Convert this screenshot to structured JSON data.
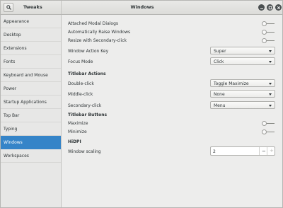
{
  "header": {
    "app_title": "Tweaks",
    "window_title": "Windows"
  },
  "sidebar": {
    "items": [
      {
        "label": "Appearance",
        "active": false
      },
      {
        "label": "Desktop",
        "active": false
      },
      {
        "label": "Extensions",
        "active": false
      },
      {
        "label": "Fonts",
        "active": false
      },
      {
        "label": "Keyboard and Mouse",
        "active": false
      },
      {
        "label": "Power",
        "active": false
      },
      {
        "label": "Startup Applications",
        "active": false
      },
      {
        "label": "Top Bar",
        "active": false
      },
      {
        "label": "Typing",
        "active": false
      },
      {
        "label": "Windows",
        "active": true
      },
      {
        "label": "Workspaces",
        "active": false
      }
    ]
  },
  "main": {
    "attached_modal_dialogs": {
      "label": "Attached Modal Dialogs",
      "on": false
    },
    "automatically_raise_windows": {
      "label": "Automatically Raise Windows",
      "on": false
    },
    "resize_secondary_click": {
      "label": "Resize with Secondary-click",
      "on": false
    },
    "window_action_key": {
      "label": "Window Action Key",
      "value": "Super"
    },
    "focus_mode": {
      "label": "Focus Mode",
      "value": "Click"
    },
    "titlebar_actions": {
      "title": "Titlebar Actions",
      "double_click": {
        "label": "Double-click",
        "value": "Toggle Maximize"
      },
      "middle_click": {
        "label": "Middle-click",
        "value": "None"
      },
      "secondary_click": {
        "label": "Secondary-click",
        "value": "Menu"
      }
    },
    "titlebar_buttons": {
      "title": "Titlebar Buttons",
      "maximize": {
        "label": "Maximize",
        "on": false
      },
      "minimize": {
        "label": "Minimize",
        "on": false
      }
    },
    "hidpi": {
      "title": "HiDPI",
      "window_scaling": {
        "label": "Window scaling",
        "value": "2",
        "minus": "−",
        "plus": "+"
      }
    }
  },
  "icons": {
    "search": "search-icon",
    "minimize": "minimize-icon",
    "maximize": "maximize-icon",
    "close": "close-icon"
  },
  "colors": {
    "accent": "#3584c8",
    "window_button": "#4a4f50"
  }
}
